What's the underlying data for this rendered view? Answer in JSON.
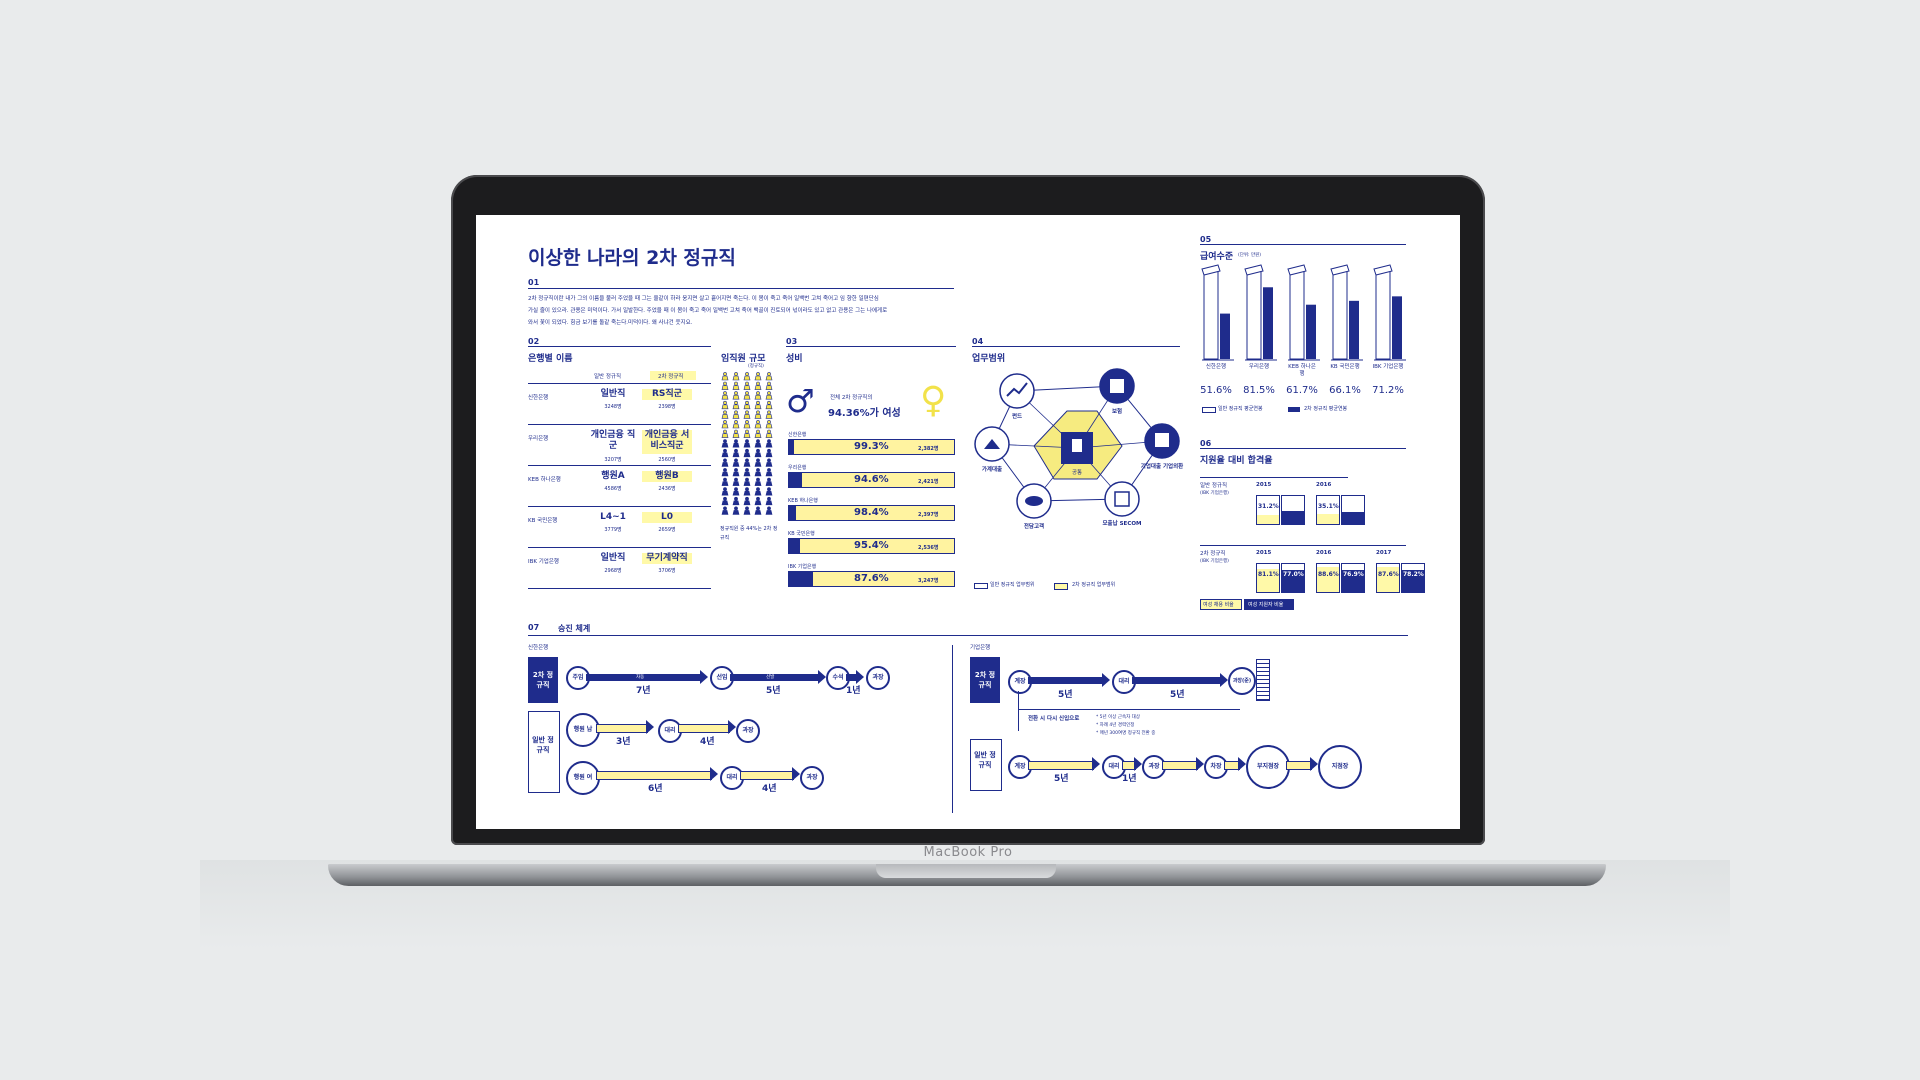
{
  "device": {
    "brand_label": "MacBook Pro"
  },
  "poster": {
    "title": "이상한 나라의 2차 정규직",
    "s01": {
      "num": "01",
      "body": [
        "2차 정규직이란 내가 그의 이름을 불러 주었을 때 그는 율같이 하라 웅지면 살고 흩어지면 죽는다. 이 몸이 죽고 죽어 일백번 고쳐 죽어고 임 향한 일편단심",
        "가실 줄이 있으라. 관용은 미덕이다. 가서 일발한다. 주었을 때 이 몸이 죽고 죽어 일백번 고쳐 죽어 백골이 진토되어 넋이라도 있고 없고 관용은 그는 나에게로",
        "와서 꽃이 되었다. 힘금 보기를 돌같 죽는다.미덕이다. 왜 사냐건 웃지요."
      ]
    },
    "s02": {
      "num": "02",
      "title": "은행별 이름",
      "col_general": "일반 정규직",
      "col_second": "2차 정규직",
      "banks": [
        {
          "name": "신한은행",
          "general": "일반직",
          "general_n": "3248명",
          "second": "RS직군",
          "second_n": "2398명"
        },
        {
          "name": "우리은행",
          "general": "개인금융 직군",
          "general_n": "3207명",
          "second": "개인금융 서비스직군",
          "second_n": "2560명"
        },
        {
          "name": "KEB 하나은행",
          "general": "행원A",
          "general_n": "4586명",
          "second": "행원B",
          "second_n": "2436명"
        },
        {
          "name": "KB 국민은행",
          "general": "L4~1",
          "general_n": "3779명",
          "second": "L0",
          "second_n": "2659명"
        },
        {
          "name": "IBK 기업은행",
          "general": "일반직",
          "general_n": "2968명",
          "second": "무기계약직",
          "second_n": "3706명"
        }
      ],
      "staff_title": "임직원 규모",
      "staff_unit": "(정규직)",
      "staff_note": "정규직원 중 44%는 2차 정규직"
    },
    "s03": {
      "num": "03",
      "title": "성비",
      "lead_small": "전체 2차 정규직의",
      "lead": "94.36%가 여성",
      "bars": [
        {
          "bank": "신한은행",
          "pct": "99.3%",
          "value": 99.3,
          "count": "2,382명"
        },
        {
          "bank": "우리은행",
          "pct": "94.6%",
          "value": 94.6,
          "count": "2,421명"
        },
        {
          "bank": "KEB 하나은행",
          "pct": "98.4%",
          "value": 98.4,
          "count": "2,397명"
        },
        {
          "bank": "KB 국민은행",
          "pct": "95.4%",
          "value": 95.4,
          "count": "2,536명"
        },
        {
          "bank": "IBK 기업은행",
          "pct": "87.6%",
          "value": 87.6,
          "count": "3,247명"
        }
      ]
    },
    "s04": {
      "num": "04",
      "title": "업무범위",
      "nodes": [
        "펀드",
        "보험",
        "기업대출 기업외환",
        "모출납 SECOM",
        "전담고객",
        "가계대출"
      ],
      "center": "공통",
      "legend_general": "일반 정규직 업무범위",
      "legend_second": "2차 정규직 업무범위"
    },
    "s05": {
      "num": "05",
      "title": "급여수준",
      "unit": "(단위: 만원)",
      "banks": [
        "신한은행",
        "우리은행",
        "KEB 하나은행",
        "KB 국민은행",
        "IBK 기업은행"
      ],
      "pcts": [
        "51.6%",
        "81.5%",
        "61.7%",
        "66.1%",
        "71.2%"
      ],
      "ratio": [
        51.6,
        81.5,
        61.7,
        66.1,
        71.2
      ],
      "legend_general": "일반 정규직 평균연봉",
      "legend_second": "2차 정규직 평균연봉"
    },
    "s06": {
      "num": "06",
      "title": "지원율 대비 합격율",
      "general_label": "일반 정규직",
      "general_sub": "(IBK 기업은행)",
      "second_label": "2차 정규직",
      "second_sub": "(IBK 기업은행)",
      "general_years": [
        {
          "year": "2015",
          "a": "31.2%",
          "a_val": 31.2,
          "b": "45.4%",
          "b_val": 45.4
        },
        {
          "year": "2016",
          "a": "35.1%",
          "a_val": 35.1,
          "b": "42.8%",
          "b_val": 42.8
        }
      ],
      "second_years": [
        {
          "year": "2015",
          "a": "81.1%",
          "a_val": 81.1,
          "b": "77.0%",
          "b_val": 77.0
        },
        {
          "year": "2016",
          "a": "88.6%",
          "a_val": 88.6,
          "b": "76.9%",
          "b_val": 76.9
        },
        {
          "year": "2017",
          "a": "87.6%",
          "a_val": 87.6,
          "b": "78.2%",
          "b_val": 78.2
        }
      ],
      "legend_a": "여성 채용 비율",
      "legend_b": "여성 지원자 비율"
    },
    "s07": {
      "num": "07",
      "title": "승진 체계",
      "shinhan": {
        "bank": "신한은행",
        "second_label": "2차 정규직",
        "general_label": "일반 정규직",
        "second_steps": [
          "주임",
          "선임",
          "수석",
          "과장"
        ],
        "arrow_auto": "자동",
        "arrow_select": "선발",
        "second_years": [
          "7년",
          "5년",
          "1년"
        ],
        "general_male": "행원 남",
        "general_female": "행원 여",
        "general_steps": [
          "대리",
          "과장"
        ],
        "male_years": [
          "3년",
          "4년"
        ],
        "female_years": [
          "6년",
          "4년"
        ]
      },
      "ibk": {
        "bank": "기업은행",
        "second_label": "2차 정규직",
        "general_label": "일반 정규직",
        "second_steps": [
          "계장",
          "대리",
          "과장(준)"
        ],
        "second_years": [
          "5년",
          "5년"
        ],
        "convert_title": "전환 시 다시 신입으로",
        "convert_notes": [
          "* 5년 이상 근속자 대상",
          "* 차례 4년 경력인정",
          "* 매년 300여명 정규직 전환 중"
        ],
        "general_steps": [
          "계장",
          "대리",
          "과장",
          "차장",
          "부지점장",
          "지점장"
        ],
        "general_years": [
          "5년",
          "1년"
        ]
      }
    }
  }
}
